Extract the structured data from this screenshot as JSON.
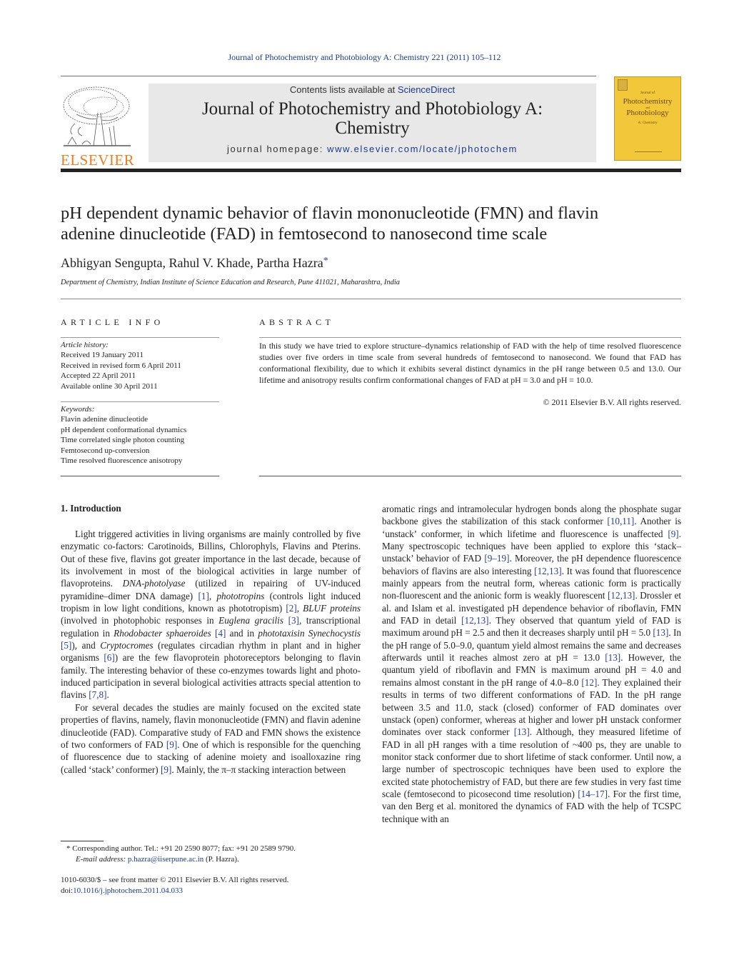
{
  "header": {
    "running_head": "Journal of Photochemistry and Photobiology A: Chemistry 221 (2011) 105–112",
    "contents_prefix": "Contents lists available at ",
    "contents_link": "ScienceDirect",
    "journal_title_line1": "Journal of Photochemistry and Photobiology A:",
    "journal_title_line2": "Chemistry",
    "homepage_prefix": "journal homepage: ",
    "homepage_link": "www.elsevier.com/locate/jphotochem",
    "publisher_logo": "ELSEVIER",
    "cover": {
      "small": "Journal of",
      "line1": "Photochemistry",
      "and": "and",
      "line2": "Photobiology",
      "sub": "A: Chemistry"
    }
  },
  "article": {
    "title_line1": "pH dependent dynamic behavior of flavin mononucleotide (FMN) and flavin",
    "title_line2": "adenine dinucleotide (FAD) in femtosecond to nanosecond time scale",
    "authors": "Abhigyan Sengupta, Rahul V. Khade, Partha Hazra",
    "author_mark": "*",
    "affiliation": "Department of Chemistry, Indian Institute of Science Education and Research, Pune 411021, Maharashtra, India"
  },
  "article_info": {
    "heading": "ARTICLE INFO",
    "history_label": "Article history:",
    "history": [
      "Received 19 January 2011",
      "Received in revised form 6 April 2011",
      "Accepted 22 April 2011",
      "Available online 30 April 2011"
    ],
    "keywords_label": "Keywords:",
    "keywords": [
      "Flavin adenine dinucleotide",
      "pH dependent conformational dynamics",
      "Time correlated single photon counting",
      "Femtosecond up-conversion",
      "Time resolved fluorescence anisotropy"
    ]
  },
  "abstract": {
    "heading": "ABSTRACT",
    "text": "In this study we have tried to explore structure–dynamics relationship of FAD with the help of time resolved fluorescence studies over five orders in time scale from several hundreds of femtosecond to nanosecond. We found that FAD has conformational flexibility, due to which it exhibits several distinct dynamics in the pH range between 0.5 and 13.0. Our lifetime and anisotropy results confirm conformational changes of FAD at pH = 3.0 and pH = 10.0.",
    "copyright": "© 2011 Elsevier B.V. All rights reserved."
  },
  "introduction": {
    "heading": "1.  Introduction",
    "p1": [
      {
        "t": "Light triggered activities in living organisms are mainly controlled by five enzymatic co-factors: Carotinoids, Billins, Chlorophyls, Flavins and Pterins. Out of these five, flavins got greater importance in the last decade, because of its involvement in most of the biological activities in large number of flavoproteins. "
      },
      {
        "t": "DNA-photolyase",
        "s": "it"
      },
      {
        "t": " (utilized in repairing of UV-induced pyramidine–dimer DNA damage) "
      },
      {
        "t": "[1]",
        "s": "cite"
      },
      {
        "t": ", "
      },
      {
        "t": "phototropins",
        "s": "it"
      },
      {
        "t": " (controls light induced tropism in low light conditions, known as phototropism) "
      },
      {
        "t": "[2]",
        "s": "cite"
      },
      {
        "t": ", "
      },
      {
        "t": "BLUF proteins",
        "s": "it"
      },
      {
        "t": " (involved in photophobic responses in "
      },
      {
        "t": "Euglena gracilis",
        "s": "it"
      },
      {
        "t": " "
      },
      {
        "t": "[3]",
        "s": "cite"
      },
      {
        "t": ", transcriptional regulation in "
      },
      {
        "t": "Rhodobacter sphaeroides",
        "s": "it"
      },
      {
        "t": " "
      },
      {
        "t": "[4]",
        "s": "cite"
      },
      {
        "t": " and in "
      },
      {
        "t": "phototaxisin Synechocystis",
        "s": "it"
      },
      {
        "t": " "
      },
      {
        "t": "[5]",
        "s": "cite"
      },
      {
        "t": "), and "
      },
      {
        "t": "Cryptocromes",
        "s": "it"
      },
      {
        "t": " (regulates circadian rhythm in plant and in higher organisms "
      },
      {
        "t": "[6]",
        "s": "cite"
      },
      {
        "t": ") are the few flavoprotein photoreceptors belonging to flavin family. The interesting behavior of these co-enzymes towards light and photo-induced participation in several biological activities attracts special attention to flavins "
      },
      {
        "t": "[7,8]",
        "s": "cite"
      },
      {
        "t": "."
      }
    ],
    "p2": [
      {
        "t": "For several decades the studies are mainly focused on the excited state properties of flavins, namely, flavin mononucleotide (FMN) and flavin adenine dinucleotide (FAD). Comparative study of FAD and FMN shows the existence of two conformers of FAD "
      },
      {
        "t": "[9]",
        "s": "cite"
      },
      {
        "t": ". One of which is responsible for the quenching of fluorescence due to stacking of adenine moiety and isoalloxazine ring (called ‘stack’ conformer) "
      },
      {
        "t": "[9]",
        "s": "cite"
      },
      {
        "t": ". Mainly, the π–π stacking interaction between"
      }
    ],
    "p3": [
      {
        "t": "aromatic rings and intramolecular hydrogen bonds along the phosphate sugar backbone gives the stabilization of this stack conformer "
      },
      {
        "t": "[10,11]",
        "s": "cite"
      },
      {
        "t": ". Another is ‘unstack’ conformer, in which lifetime and fluorescence is unaffected "
      },
      {
        "t": "[9]",
        "s": "cite"
      },
      {
        "t": ". Many spectroscopic techniques have been applied to explore this ‘stack–unstack’ behavior of FAD "
      },
      {
        "t": "[9–19]",
        "s": "cite"
      },
      {
        "t": ". Moreover, the pH dependence fluorescence behaviors of flavins are also interesting "
      },
      {
        "t": "[12,13]",
        "s": "cite"
      },
      {
        "t": ". It was found that fluorescence mainly appears from the neutral form, whereas cationic form is practically non-fluorescent and the anionic form is weakly fluorescent "
      },
      {
        "t": "[12,13]",
        "s": "cite"
      },
      {
        "t": ". Drossler et al. and Islam et al. investigated pH dependence behavior of riboflavin, FMN and FAD in detail "
      },
      {
        "t": "[12,13]",
        "s": "cite"
      },
      {
        "t": ". They observed that quantum yield of FAD is maximum around pH = 2.5 and then it decreases sharply until pH = 5.0 "
      },
      {
        "t": "[13]",
        "s": "cite"
      },
      {
        "t": ". In the pH range of 5.0–9.0, quantum yield almost remains the same and decreases afterwards until it reaches almost zero at pH = 13.0 "
      },
      {
        "t": "[13]",
        "s": "cite"
      },
      {
        "t": ". However, the quantum yield of riboflavin and FMN is maximum around pH = 4.0 and remains almost constant in the pH range of 4.0–8.0 "
      },
      {
        "t": "[12]",
        "s": "cite"
      },
      {
        "t": ". They explained their results in terms of two different conformations of FAD. In the pH range between 3.5 and 11.0, stack (closed) conformer of FAD dominates over unstack (open) conformer, whereas at higher and lower pH unstack conformer dominates over stack conformer "
      },
      {
        "t": "[13]",
        "s": "cite"
      },
      {
        "t": ". Although, they measured lifetime of FAD in all pH ranges with a time resolution of ~400 ps, they are unable to monitor stack conformer due to short lifetime of stack conformer. Until now, a large number of spectroscopic techniques have been used to explore the excited state photochemistry of FAD, but there are few studies in very fast time scale (femtosecond to picosecond time resolution) "
      },
      {
        "t": "[14–17]",
        "s": "cite"
      },
      {
        "t": ". For the first time, van den Berg et al. monitored the dynamics of FAD with the help of TCSPC technique with an"
      }
    ]
  },
  "footnote": {
    "mark": "*",
    "line1": "Corresponding author. Tel.: +91 20 2590 8077; fax: +91 20 2589 9790.",
    "email_label": "E-mail address:",
    "email": "p.hazra@iiserpune.ac.in",
    "email_suffix": " (P. Hazra)."
  },
  "frontmatter": {
    "issn_line": "1010-6030/$ – see front matter © 2011 Elsevier B.V. All rights reserved.",
    "doi_prefix": "doi:",
    "doi": "10.1016/j.jphotochem.2011.04.033"
  }
}
